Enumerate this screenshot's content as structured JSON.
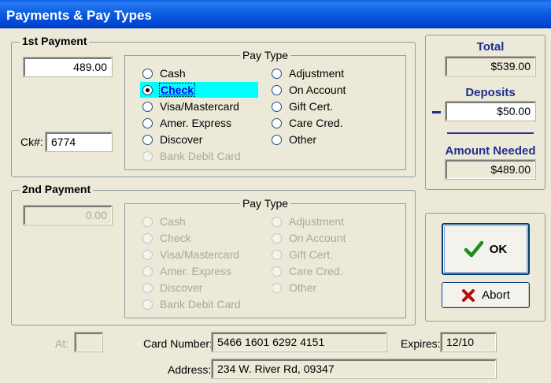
{
  "window": {
    "title": "Payments & Pay Types"
  },
  "first_payment": {
    "title": "1st Payment",
    "amount": "489.00",
    "check_label": "Ck#:",
    "check_number": "6774",
    "pay_type_title": "Pay Type",
    "options_left": [
      "Cash",
      "Check",
      "Visa/Mastercard",
      "Amer. Express",
      "Discover",
      "Bank Debit Card"
    ],
    "options_right": [
      "Adjustment",
      "On Account",
      "Gift Cert.",
      "Care Cred.",
      "Other"
    ],
    "selected": "Check"
  },
  "second_payment": {
    "title": "2nd Payment",
    "amount": "0.00",
    "pay_type_title": "Pay Type",
    "options_left": [
      "Cash",
      "Check",
      "Visa/Mastercard",
      "Amer. Express",
      "Discover",
      "Bank Debit Card"
    ],
    "options_right": [
      "Adjustment",
      "On Account",
      "Gift Cert.",
      "Care Cred.",
      "Other"
    ]
  },
  "totals": {
    "total_label": "Total",
    "total_value": "$539.00",
    "deposits_label": "Deposits",
    "deposits_value": "$50.00",
    "amount_needed_label": "Amount Needed",
    "amount_needed_value": "$489.00"
  },
  "buttons": {
    "ok_label": "OK",
    "abort_label": "Abort"
  },
  "footer": {
    "at_label": "At:",
    "at_value": "",
    "card_number_label": "Card Number:",
    "card_number_value": "5466 1601 6292 4151",
    "expires_label": "Expires:",
    "expires_value": "12/10",
    "address_label": "Address:",
    "address_value": "234 W. River Rd,  09347"
  },
  "colors": {
    "title_bar": "#0a5fe6",
    "selection": "#00ffff",
    "label_blue": "#1f2f8f",
    "ok_check": "#1e8c1e",
    "abort_x": "#b01010"
  },
  "icons": {
    "ok": "checkmark-icon",
    "abort": "x-icon"
  }
}
